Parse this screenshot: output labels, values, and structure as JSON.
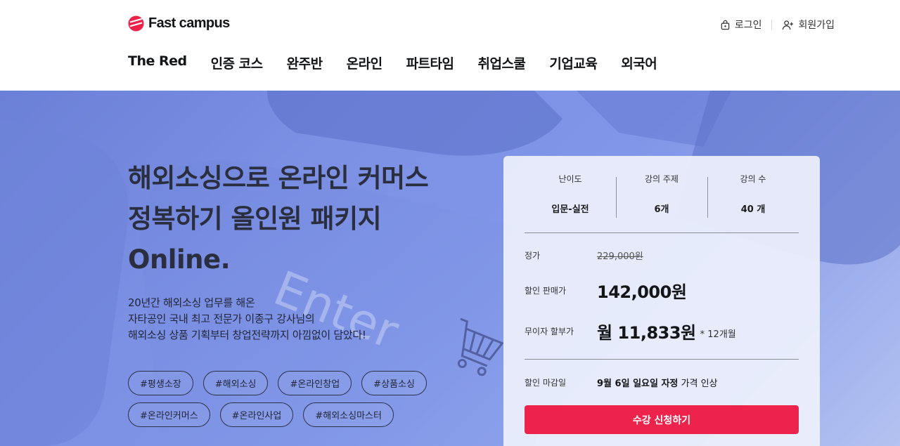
{
  "brand": {
    "name": "Fast campus",
    "accent": "#ed234b"
  },
  "header": {
    "login": {
      "label": "로그인",
      "icon": "lock-icon"
    },
    "signup": {
      "label": "회원가입",
      "icon": "add-user-icon"
    },
    "nav": [
      "The Red",
      "인증 코스",
      "완주반",
      "온라인",
      "파트타임",
      "취업스쿨",
      "기업교육",
      "외국어"
    ]
  },
  "hero": {
    "title_lines": [
      "해외소싱으로 온라인 커머스",
      "정복하기 올인원 패키지",
      "Online."
    ],
    "desc_lines": [
      "20년간 해외소싱 업무를 해온",
      "자타공인 국내 최고 전문가 이종구 강사님의",
      "해외소싱 상품 기획부터 창업전략까지 아낌없이 담았다!"
    ],
    "tags": [
      "#평생소장",
      "#해외소싱",
      "#온라인창업",
      "#상품소싱",
      "#온라인커머스",
      "#온라인사업",
      "#해외소싱마스터"
    ],
    "background_key_text": "Enter"
  },
  "card": {
    "stats": [
      {
        "label": "난이도",
        "value": "입문-실전"
      },
      {
        "label": "강의 주제",
        "value": "6개"
      },
      {
        "label": "강의 수",
        "value": "40 개"
      }
    ],
    "regular_price": {
      "label": "정가",
      "value": "229,000원"
    },
    "sale_price": {
      "label": "할인 판매가",
      "value": "142,000원"
    },
    "installment": {
      "label": "무이자 할부가",
      "value": "월 11,833원",
      "note": "* 12개월"
    },
    "deadline": {
      "label": "할인 마감일",
      "date": "9월 6일 일요일 자정",
      "suffix": "가격 인상"
    },
    "cta": "수강 신청하기"
  }
}
